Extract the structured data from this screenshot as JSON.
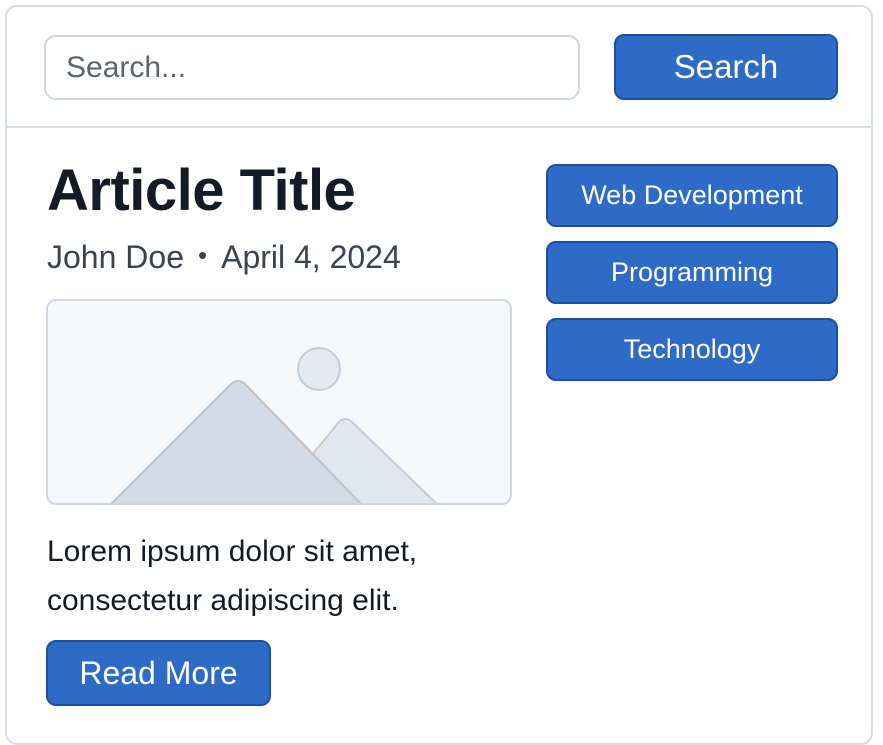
{
  "search": {
    "placeholder": "Search...",
    "button_label": "Search"
  },
  "article": {
    "title": "Article Title",
    "author": "John Doe",
    "separator": "•",
    "date": "April 4, 2024",
    "image_icon": "image-placeholder-icon",
    "body": "Lorem ipsum dolor sit amet, consectetur adipiscing elit.",
    "read_more_label": "Read More"
  },
  "tags": [
    {
      "label": "Web Development"
    },
    {
      "label": "Programming"
    },
    {
      "label": "Technology"
    }
  ],
  "colors": {
    "accent": "#2e6bc6",
    "accent_border": "#1e4fa0",
    "border": "#d6dde6",
    "title": "#141b27",
    "meta": "#3b4350"
  }
}
